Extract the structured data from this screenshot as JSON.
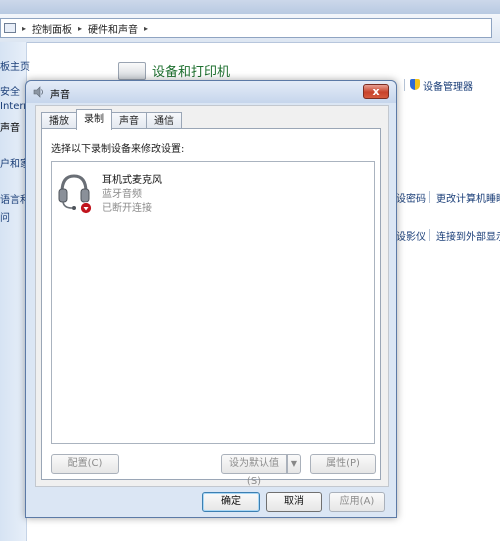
{
  "control_panel": {
    "breadcrumb": [
      "控制面板",
      "硬件和声音"
    ],
    "sidebar_links": [
      "板主页",
      "安全",
      "Intern",
      "声音",
      "户和家",
      "语言和",
      "问"
    ],
    "section_title": "设备和打印机",
    "device_manager_link": "设备管理器",
    "link_password": "设密码",
    "link_change_name": "更改计算机睡眠",
    "link_projector": "设影仪",
    "link_external_display": "连接到外部显示"
  },
  "dialog": {
    "title": "声音",
    "close_label": "x",
    "tabs": [
      {
        "label": "播放"
      },
      {
        "label": "录制"
      },
      {
        "label": "声音"
      },
      {
        "label": "通信"
      }
    ],
    "active_tab": "录制",
    "instruction": "选择以下录制设备来修改设置:",
    "devices": [
      {
        "name": "耳机式麦克风",
        "type": "蓝牙音频",
        "status": "已断开连接"
      }
    ],
    "buttons": {
      "configure": "配置(C)",
      "set_default": "设为默认值(S)",
      "properties": "属性(P)",
      "ok": "确定",
      "cancel": "取消",
      "apply": "应用(A)"
    }
  },
  "colors": {
    "link": "#1a3e78",
    "section_title": "#1d6f2e",
    "close_button": "#c8432b",
    "status_disconnected": "#c0131c"
  }
}
